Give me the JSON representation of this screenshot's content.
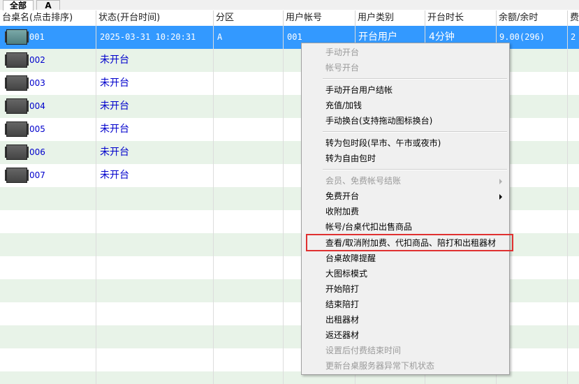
{
  "tabs": [
    {
      "label": "全部"
    },
    {
      "label": "A"
    }
  ],
  "columns": [
    "台桌名(点击排序)",
    "状态(开台时间)",
    "分区",
    "用户帐号",
    "用户类别",
    "开台时长",
    "余额/余时",
    "费"
  ],
  "rows": [
    {
      "name": "001",
      "status": "2025-03-31 10:20:31",
      "zone": "A",
      "account": "001",
      "user_type": "开台用户",
      "duration": "4分钟",
      "balance": "9.00(296)",
      "fee": "2"
    },
    {
      "name": "002",
      "status": "未开台"
    },
    {
      "name": "003",
      "status": "未开台"
    },
    {
      "name": "004",
      "status": "未开台"
    },
    {
      "name": "005",
      "status": "未开台"
    },
    {
      "name": "006",
      "status": "未开台"
    },
    {
      "name": "007",
      "status": "未开台"
    }
  ],
  "context_menu": {
    "items": [
      {
        "label": "手动开台",
        "enabled": false
      },
      {
        "label": "帐号开台",
        "enabled": false
      },
      {
        "label": "手动开台用户结帐",
        "enabled": true
      },
      {
        "label": "充值/加钱",
        "enabled": true
      },
      {
        "label": "手动换台(支持拖动图标换台)",
        "enabled": true
      },
      {
        "label": "转为包时段(早市、午市或夜市)",
        "enabled": true
      },
      {
        "label": "转为自由包时",
        "enabled": true
      },
      {
        "label": "会员、免费帐号结账",
        "enabled": false,
        "submenu": true
      },
      {
        "label": "免费开台",
        "enabled": true,
        "submenu": true
      },
      {
        "label": "收附加费",
        "enabled": true
      },
      {
        "label": "帐号/台桌代扣出售商品",
        "enabled": true
      },
      {
        "label": "查看/取消附加费、代扣商品、陪打和出租器材",
        "enabled": true,
        "highlighted": true
      },
      {
        "label": "台桌故障提醒",
        "enabled": true
      },
      {
        "label": "大图标模式",
        "enabled": true
      },
      {
        "label": "开始陪打",
        "enabled": true
      },
      {
        "label": "结束陪打",
        "enabled": true
      },
      {
        "label": "出租器材",
        "enabled": true
      },
      {
        "label": "返还器材",
        "enabled": true
      },
      {
        "label": "设置后付费结束时间",
        "enabled": false
      },
      {
        "label": "更新台桌服务器异常下机状态",
        "enabled": false
      }
    ]
  },
  "colors": {
    "selected_row": "#3399ff",
    "alt_row": "#e8f3e8",
    "link_text": "#0000cc",
    "highlight_box": "#e03030"
  }
}
